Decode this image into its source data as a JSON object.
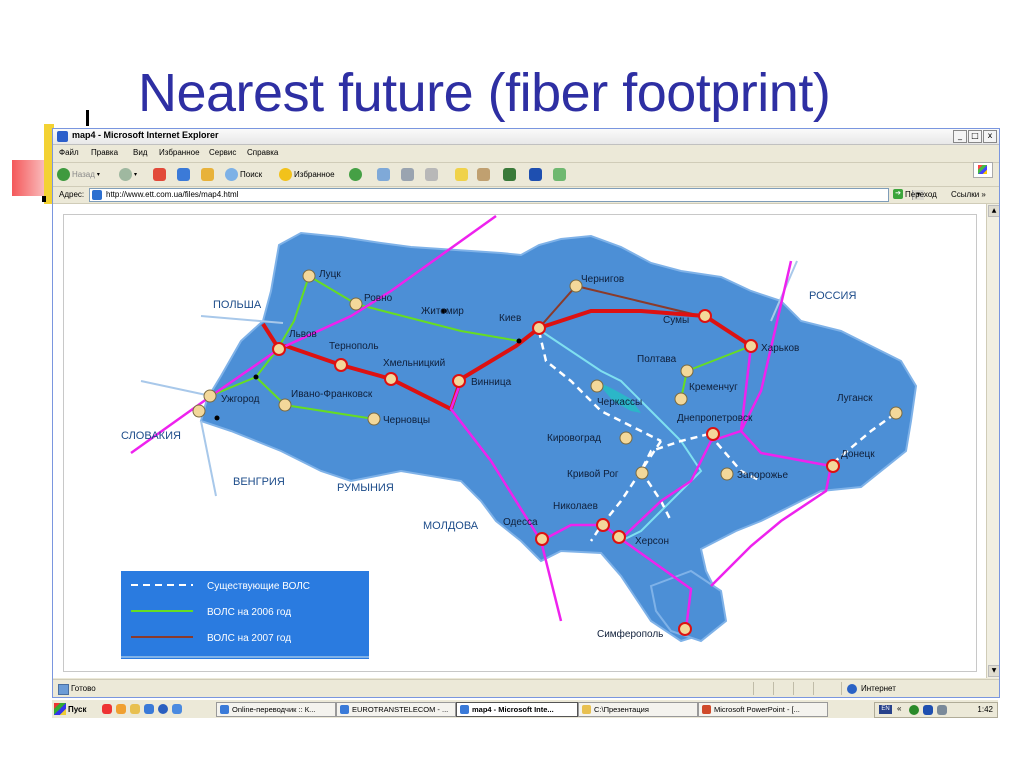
{
  "slide": {
    "title": "Nearest future (fiber footprint)"
  },
  "window": {
    "title": "map4 - Microsoft Internet Explorer",
    "buttons": {
      "minimize": "_",
      "maximize": "□",
      "close": "x"
    }
  },
  "menu": [
    "Файл",
    "Правка",
    "Вид",
    "Избранное",
    "Сервис",
    "Справка"
  ],
  "toolbar": {
    "back": "Назад",
    "search": "Поиск",
    "favorites": "Избранное"
  },
  "address": {
    "label": "Адрес:",
    "url": "http://www.ett.com.ua/files/map4.html",
    "go": "Переход",
    "links": "Ссылки"
  },
  "map": {
    "countries": [
      "ПОЛЬША",
      "СЛОВАКИЯ",
      "ВЕНГРИЯ",
      "РУМЫНИЯ",
      "МОЛДОВА",
      "РОССИЯ"
    ],
    "cities": [
      "Луцк",
      "Ровно",
      "Житомир",
      "Киев",
      "Чернигов",
      "Сумы",
      "Харьков",
      "Львов",
      "Тернополь",
      "Хмельницкий",
      "Винница",
      "Полтава",
      "Кременчуг",
      "Ужгород",
      "Ивано-Франковск",
      "Черновцы",
      "Черкассы",
      "Днепропетровск",
      "Луганск",
      "Кировоград",
      "Кривой Рог",
      "Запорожье",
      "Донецк",
      "Николаев",
      "Одесса",
      "Херсон",
      "Симферополь"
    ],
    "legend": [
      {
        "label": "Существующие ВОЛС",
        "color": "#ffffff"
      },
      {
        "label": "ВОЛС на 2006 год",
        "color": "#66dd22"
      },
      {
        "label": "ВОЛС на 2007 год",
        "color": "#8b3a2a"
      }
    ],
    "colors": {
      "red_route": "#dd1111",
      "magenta_route": "#ee22ee",
      "land": "#4c8fd6",
      "sea": "#ffffff"
    }
  },
  "status": {
    "text": "Готово",
    "zone": "Интернет"
  },
  "taskbar": {
    "start": "Пуск",
    "tasks": [
      "Online-переводчик :: К...",
      "EUROTRANSTELECOM - ...",
      "map4 - Microsoft Inte...",
      "C:\\Презентация",
      "Microsoft PowerPoint - [..."
    ],
    "lang": "EN",
    "time": "1:42"
  }
}
